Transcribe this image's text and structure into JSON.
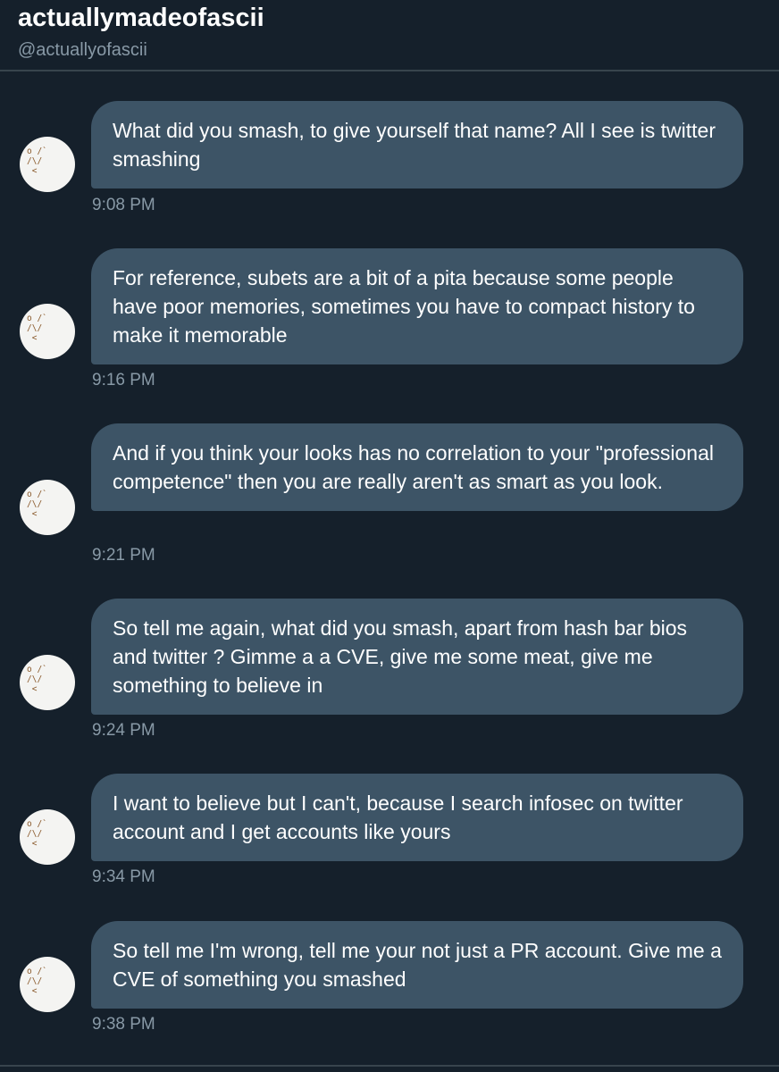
{
  "header": {
    "display_name": "actuallymadeofascii",
    "handle": "@actuallyofascii"
  },
  "avatar": {
    "icon": "ascii-face-icon",
    "art": "o /`\n/\\/ \n <"
  },
  "messages": [
    {
      "text": "What did you smash, to give yourself that name? All I see is twitter smashing",
      "time": "9:08 PM"
    },
    {
      "text": "For reference, subets are a bit of a pita because some people have poor memories, sometimes you have to compact history to make it memorable",
      "time": "9:16 PM"
    },
    {
      "text": "And if you think your looks has no correlation to your \"professional competence\" then you are really aren't as smart as you look.",
      "time": "9:21 PM"
    },
    {
      "text": "So tell me again, what did you smash, apart from hash bar bios and twitter ? Gimme a a CVE, give me some meat, give me something to believe in",
      "time": "9:24 PM"
    },
    {
      "text": "I want to believe but I can't, because I search infosec on twitter account and I get accounts like yours",
      "time": "9:34 PM"
    },
    {
      "text": "So tell me I'm wrong, tell me your not just a PR account. Give me a CVE of something you smashed",
      "time": "9:38 PM"
    }
  ]
}
